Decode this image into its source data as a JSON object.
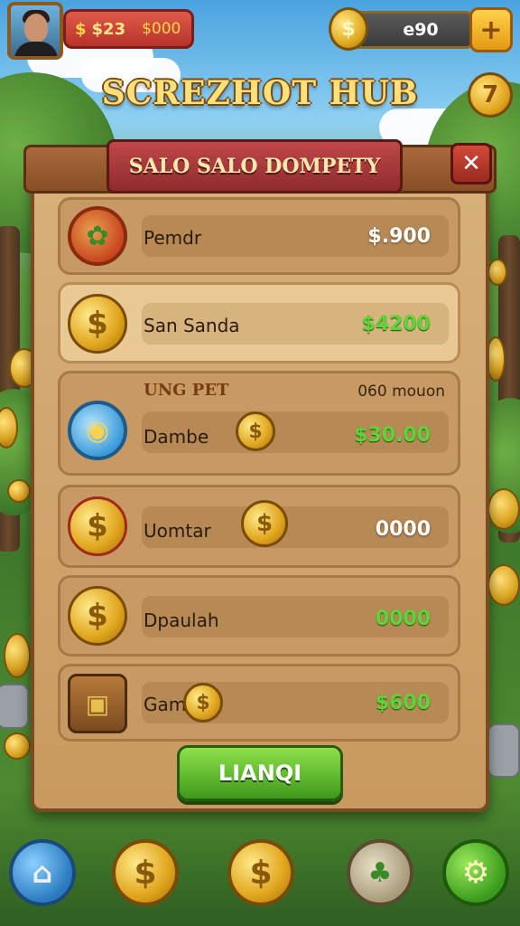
{
  "hud": {
    "money_icon": "$",
    "money_value": "$23",
    "money_secondary": "$000",
    "coin_value": "e90",
    "coin_icon": "coin-icon",
    "plus_label": "+",
    "side_button_icon": "7"
  },
  "title": "SCREZHOT HUB",
  "panel": {
    "title": "SALO SALO DOMPETY",
    "close_label": "✕"
  },
  "rows": [
    {
      "name": "Pemdr",
      "value": "$.900",
      "value_color": "white",
      "icon": "red-leaf-medal-icon"
    },
    {
      "name": "San Sanda",
      "value": "$4200",
      "value_color": "green",
      "icon": "gold-coin-icon"
    },
    {
      "name": "Dambe",
      "value": "$30.00",
      "value_color": "green",
      "icon": "blue-medal-icon",
      "sub_left": "UNG PET",
      "sub_right": "060 mouon"
    },
    {
      "name": "Uomtar",
      "value": "0000",
      "value_color": "white",
      "icon": "gold-coin-icon"
    },
    {
      "name": "Dpaulah",
      "value": "0000",
      "value_color": "green",
      "icon": "gold-coin-icon"
    },
    {
      "name": "Gam",
      "value": "$600",
      "value_color": "green",
      "icon": "treasure-chest-icon"
    }
  ],
  "action_button": "LIANQI",
  "bottom_bar": [
    {
      "icon": "home-icon"
    },
    {
      "icon": "coin-icon"
    },
    {
      "icon": "coin-icon"
    },
    {
      "icon": "card-icon"
    },
    {
      "icon": "gear-icon"
    }
  ],
  "colors": {
    "accent_green": "#5fd43a",
    "panel_bg": "#d8b07a",
    "title_red": "#a83a3a",
    "gold": "#e0a51c"
  }
}
